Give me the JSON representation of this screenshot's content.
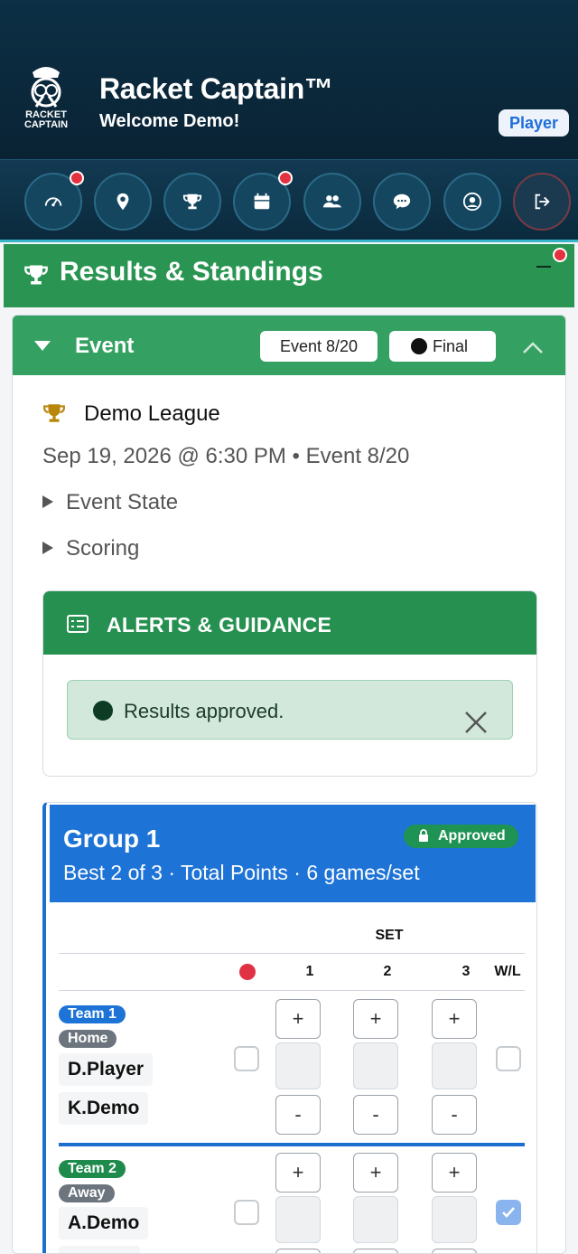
{
  "header": {
    "app_name": "Racket Captain™",
    "welcome": "Welcome Demo!",
    "role": "Player",
    "logo_text_1": "RACKET",
    "logo_text_2": "CAPTAIN"
  },
  "nav": [
    {
      "icon": "dashboard-icon",
      "has_alert": true
    },
    {
      "icon": "location-pin-icon",
      "has_alert": false
    },
    {
      "icon": "trophy-icon",
      "has_alert": false
    },
    {
      "icon": "calendar-icon",
      "has_alert": true
    },
    {
      "icon": "team-icon",
      "has_alert": false
    },
    {
      "icon": "chat-icon",
      "has_alert": false
    },
    {
      "icon": "profile-icon",
      "has_alert": false
    },
    {
      "icon": "logout-icon",
      "has_alert": false
    }
  ],
  "section": {
    "title": "Results & Standings",
    "minimize": "_"
  },
  "event": {
    "label": "Event",
    "event_pill": "Event 8/20",
    "status_pill": "Final",
    "league": "Demo League",
    "date_line": "Sep 19, 2026 @ 6:30 PM • Event 8/20",
    "disclosures": [
      "Event State",
      "Scoring"
    ]
  },
  "alerts": {
    "title": "ALERTS & GUIDANCE",
    "message": "Results approved."
  },
  "group": {
    "title": "Group 1",
    "subtitle": "Best 2 of 3 · Total Points · 6 games/set",
    "badge": "Approved",
    "set_header": "SET",
    "columns": [
      "1",
      "2",
      "3"
    ],
    "wl_header": "W/L",
    "teams": [
      {
        "team": "Team 1",
        "side": "Home",
        "players": [
          "D.Player",
          "K.Demo"
        ],
        "won": false
      },
      {
        "team": "Team 2",
        "side": "Away",
        "players": [
          "A.Demo",
          ""
        ],
        "won": true
      }
    ],
    "plus": "+",
    "minus": "-"
  },
  "colors": {
    "header_bg": "#0c2f45",
    "results_green": "#2a9552",
    "group_blue": "#1d73d6",
    "alert_dot": "#e3313f"
  }
}
